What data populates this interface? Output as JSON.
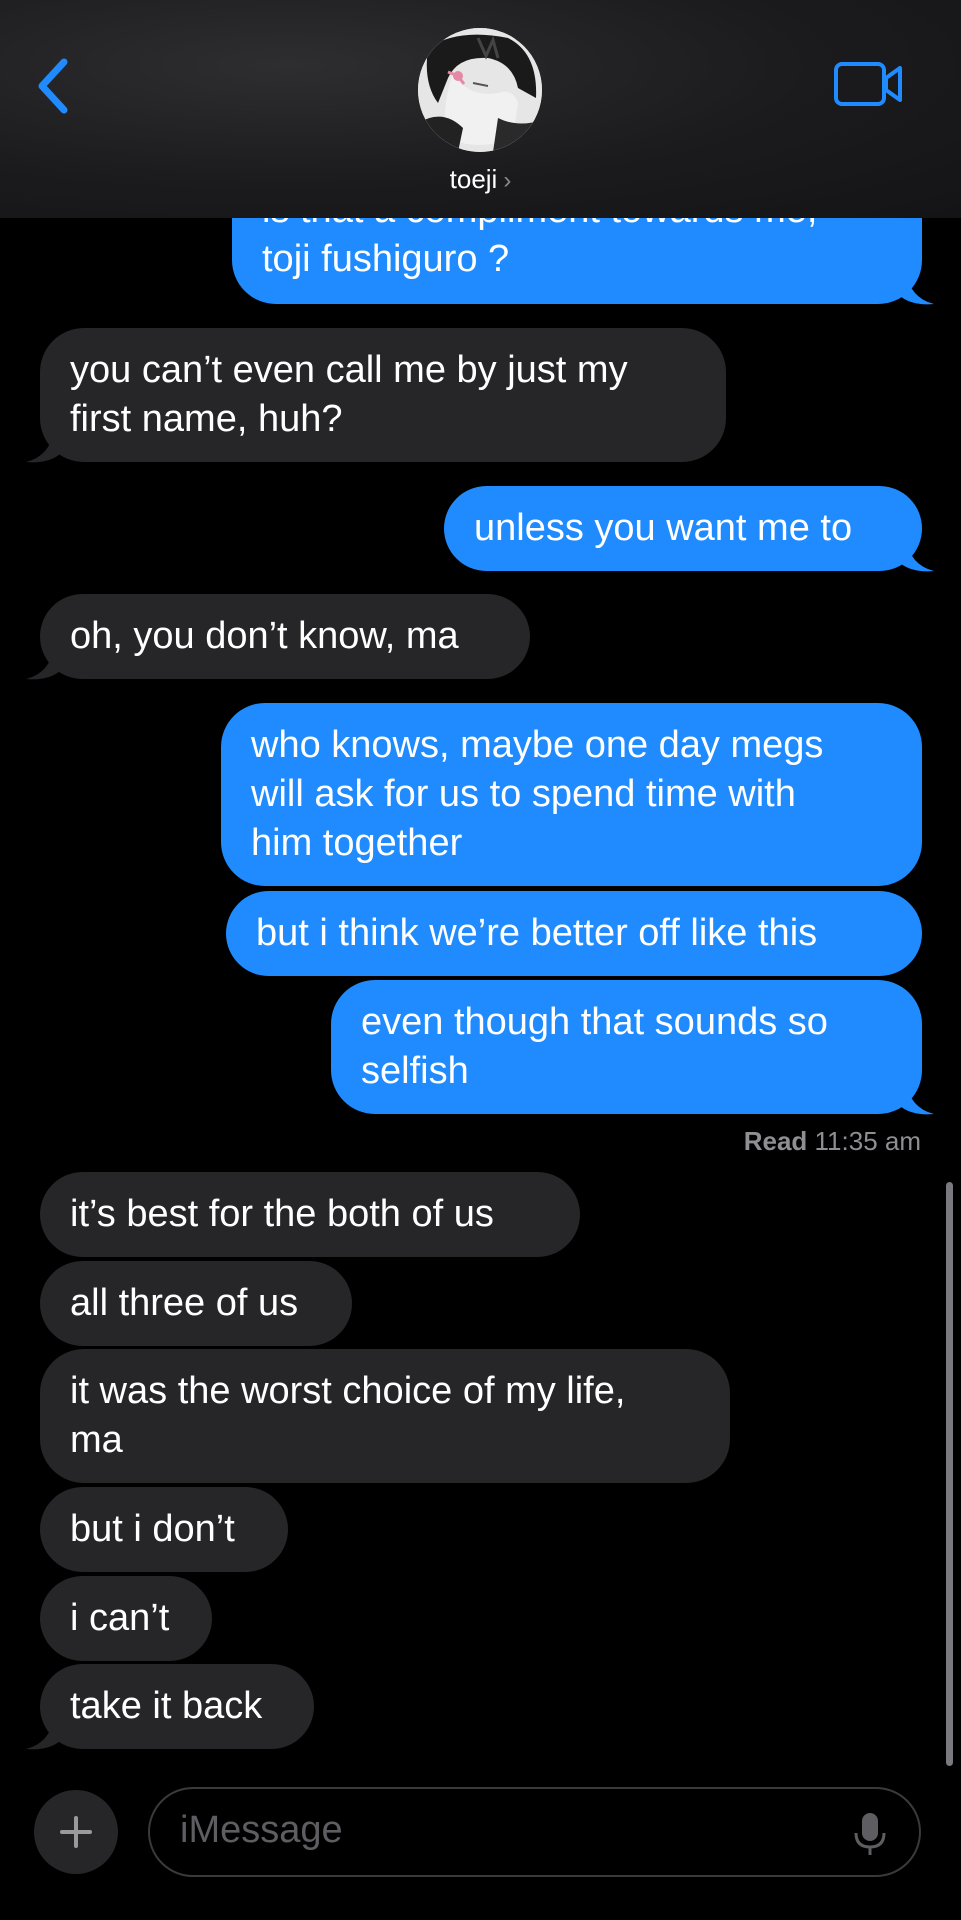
{
  "header": {
    "contact_name": "toeji",
    "chevron": "›",
    "back_icon": "chevron-left-icon",
    "video_icon": "video-camera-icon",
    "accent": "#1f8bff"
  },
  "messages": [
    {
      "side": "sent",
      "lines": [
        "is that a compliment towards me,",
        "toji fushiguro ?"
      ]
    },
    {
      "side": "received",
      "lines": [
        "you can’t even call me by just my",
        "first name, huh?"
      ]
    },
    {
      "side": "sent",
      "lines": [
        "unless you want me to"
      ]
    },
    {
      "side": "received",
      "lines": [
        "oh, you don’t know, ma"
      ]
    },
    {
      "side": "sent",
      "lines": [
        "who knows, maybe one day megs",
        "will ask for us to spend time with",
        "him together"
      ]
    },
    {
      "side": "sent",
      "lines": [
        "but i think we’re better off like this"
      ]
    },
    {
      "side": "sent",
      "lines": [
        "even though that sounds so",
        "selfish"
      ]
    },
    {
      "side": "received",
      "lines": [
        "it’s best for the both of us"
      ]
    },
    {
      "side": "received",
      "lines": [
        "all three of us"
      ]
    },
    {
      "side": "received",
      "lines": [
        "it was the worst choice of my life,",
        "ma"
      ]
    },
    {
      "side": "received",
      "lines": [
        "but i don’t"
      ]
    },
    {
      "side": "received",
      "lines": [
        "i can’t"
      ]
    },
    {
      "side": "received",
      "lines": [
        "take it back"
      ]
    }
  ],
  "read_receipt": {
    "label": "Read",
    "time": "11:35 am"
  },
  "composer": {
    "placeholder": "iMessage",
    "plus_icon": "plus-icon",
    "mic_icon": "microphone-icon"
  },
  "colors": {
    "sent": "#1f8bff",
    "received": "#262628",
    "background": "#000000"
  }
}
